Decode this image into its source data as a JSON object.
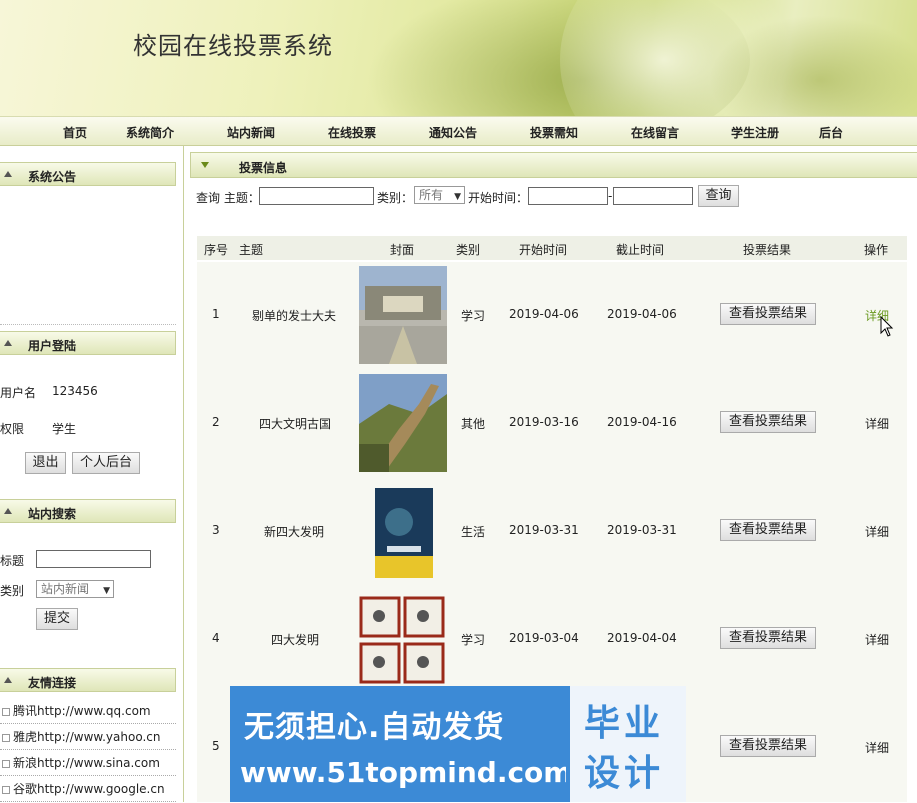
{
  "header": {
    "title": "校园在线投票系统"
  },
  "nav": [
    {
      "label": "首页"
    },
    {
      "label": "系统简介"
    },
    {
      "label": "站内新闻"
    },
    {
      "label": "在线投票"
    },
    {
      "label": "通知公告"
    },
    {
      "label": "投票需知"
    },
    {
      "label": "在线留言"
    },
    {
      "label": "学生注册"
    },
    {
      "label": "后台"
    }
  ],
  "sidebar": {
    "notice": {
      "title": "系统公告"
    },
    "login": {
      "title": "用户登陆",
      "username_label": "用户名",
      "username": "123456",
      "role_label": "权限",
      "role": "学生",
      "logout": "退出",
      "personal": "个人后台"
    },
    "search": {
      "title": "站内搜索",
      "title_label": "标题",
      "category_label": "类别",
      "category_value": "站内新闻",
      "submit": "提交"
    },
    "links": {
      "title": "友情连接",
      "items": [
        {
          "label": "腾讯http://www.qq.com"
        },
        {
          "label": "雅虎http://www.yahoo.cn"
        },
        {
          "label": "新浪http://www.sina.com"
        },
        {
          "label": "谷歌http://www.google.cn"
        }
      ]
    }
  },
  "main": {
    "section_title": "投票信息",
    "filter": {
      "query_label": "查询 主题：",
      "category_label": "类别：",
      "category_value": "所有",
      "start_label": "开始时间：",
      "dash": "-",
      "search_button": "查询"
    },
    "columns": [
      "序号",
      "主题",
      "封面",
      "类别",
      "开始时间",
      "截止时间",
      "投票结果",
      "操作"
    ],
    "rows": [
      {
        "no": "1",
        "topic": "剔单的发士大夫",
        "category": "学习",
        "start": "2019-04-06",
        "end": "2019-04-06",
        "result": "查看投票结果",
        "action": "详细"
      },
      {
        "no": "2",
        "topic": "四大文明古国",
        "category": "其他",
        "start": "2019-03-16",
        "end": "2019-04-16",
        "result": "查看投票结果",
        "action": "详细"
      },
      {
        "no": "3",
        "topic": "新四大发明",
        "category": "生活",
        "start": "2019-03-31",
        "end": "2019-03-31",
        "result": "查看投票结果",
        "action": "详细"
      },
      {
        "no": "4",
        "topic": "四大发明",
        "category": "学习",
        "start": "2019-03-04",
        "end": "2019-04-04",
        "result": "查看投票结果",
        "action": "详细"
      },
      {
        "no": "5",
        "topic": "",
        "category": "",
        "start": "",
        "end": "",
        "result": "查看投票结果",
        "action": "详细"
      }
    ]
  },
  "watermark": {
    "line1": "无须担心.自动发货",
    "line2": "www.51topmind.com",
    "box1": "毕业",
    "box2": "设计"
  }
}
